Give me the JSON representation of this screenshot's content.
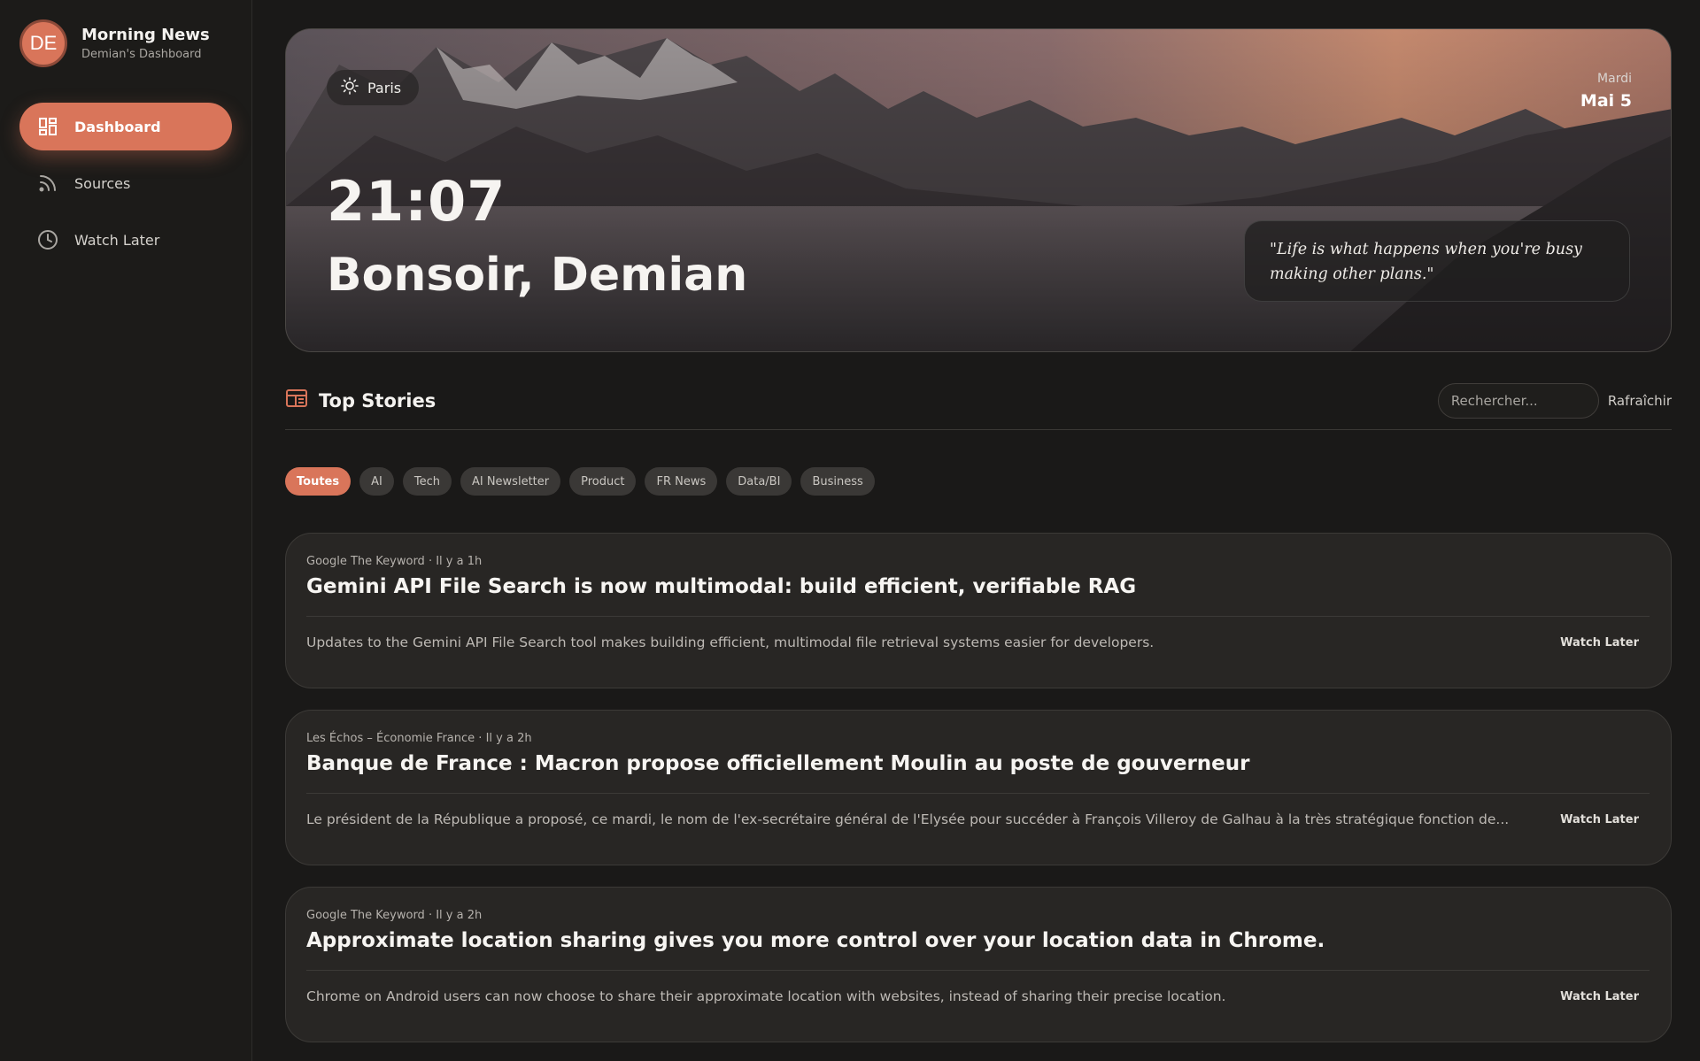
{
  "brand": {
    "initials": "DE",
    "title": "Morning News",
    "subtitle": "Demian's Dashboard"
  },
  "nav": [
    {
      "label": "Dashboard",
      "icon": "dashboard-grid-icon",
      "active": true
    },
    {
      "label": "Sources",
      "icon": "rss-icon",
      "active": false
    },
    {
      "label": "Watch Later",
      "icon": "clock-icon",
      "active": false
    }
  ],
  "hero": {
    "location": "Paris",
    "weather_icon": "sun-icon",
    "day": "Mardi",
    "date": "Mai 5",
    "time": "21:07",
    "greeting": "Bonsoir, Demian",
    "quote": "\"Life is what happens when you're busy making other plans.\""
  },
  "stories": {
    "title": "Top Stories",
    "search_placeholder": "Rechercher...",
    "refresh_label": "Rafraîchir"
  },
  "filters": [
    {
      "label": "Toutes",
      "active": true
    },
    {
      "label": "AI",
      "active": false
    },
    {
      "label": "Tech",
      "active": false
    },
    {
      "label": "AI Newsletter",
      "active": false
    },
    {
      "label": "Product",
      "active": false
    },
    {
      "label": "FR News",
      "active": false
    },
    {
      "label": "Data/BI",
      "active": false
    },
    {
      "label": "Business",
      "active": false
    }
  ],
  "articles": [
    {
      "source": "Google The Keyword",
      "age": "Il y a 1h",
      "title": "Gemini API File Search is now multimodal: build efficient, verifiable RAG",
      "description": "Updates to the Gemini API File Search tool makes building efficient, multimodal file retrieval systems easier for developers.",
      "action": "Watch Later"
    },
    {
      "source": "Les Échos – Économie France",
      "age": "Il y a 2h",
      "title": "Banque de France : Macron propose officiellement Moulin au poste de gouverneur",
      "description": "Le président de la République a proposé, ce mardi, le nom de l'ex-secrétaire général de l'Elysée pour succéder à François Villeroy de Galhau à la très stratégique fonction de...",
      "action": "Watch Later"
    },
    {
      "source": "Google The Keyword",
      "age": "Il y a 2h",
      "title": "Approximate location sharing gives you more control over your location data in Chrome.",
      "description": "Chrome on Android users can now choose to share their approximate location with websites, instead of sharing their precise location.",
      "action": "Watch Later"
    }
  ],
  "colors": {
    "accent": "#d9755a",
    "background": "#1a1918",
    "card": "#282624"
  }
}
